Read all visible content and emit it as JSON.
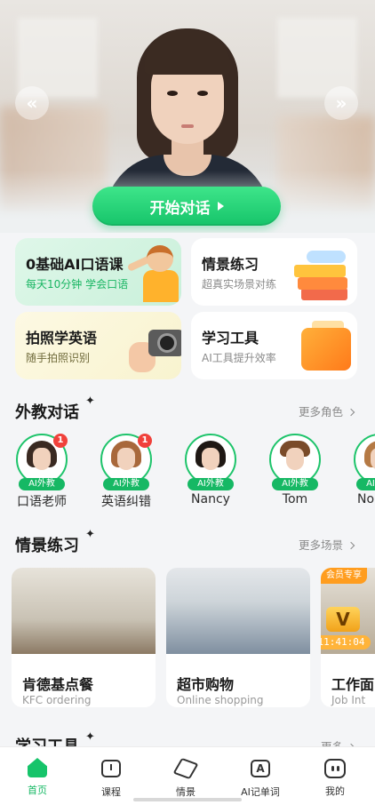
{
  "hero": {
    "start_button": "开始对话",
    "prev_icon": "double-chevron-left-icon",
    "next_icon": "double-chevron-right-icon"
  },
  "features": [
    {
      "title": "0基础AI口语课",
      "subtitle": "每天10分钟 学会口语"
    },
    {
      "title": "情景练习",
      "subtitle": "超真实场景对练"
    },
    {
      "title": "拍照学英语",
      "subtitle": "随手拍照识别"
    },
    {
      "title": "学习工具",
      "subtitle": "AI工具提升效率"
    }
  ],
  "tutors_section": {
    "title": "外教对话",
    "more": "更多角色",
    "tutors": [
      {
        "name": "口语老师",
        "badge": "AI外教",
        "unread": "1"
      },
      {
        "name": "英语纠错",
        "badge": "AI外教",
        "unread": "1"
      },
      {
        "name": "Nancy",
        "badge": "AI外教"
      },
      {
        "name": "Tom",
        "badge": "AI外教"
      },
      {
        "name": "No",
        "badge": "AI外教"
      }
    ]
  },
  "scenes_section": {
    "title": "情景练习",
    "more": "更多场景",
    "scenes": [
      {
        "title": "肯德基点餐",
        "subtitle": "KFC ordering"
      },
      {
        "title": "超市购物",
        "subtitle": "Online shopping"
      },
      {
        "title": "工作面",
        "subtitle": "Job Int",
        "tag": "会员专享",
        "timer": "11:41:04",
        "vip_mark": "V"
      }
    ]
  },
  "tools_section": {
    "title": "学习工具",
    "more": "更多"
  },
  "tabbar": {
    "tabs": [
      {
        "label": "首页",
        "icon": "home-icon",
        "active": true
      },
      {
        "label": "课程",
        "icon": "course-book-icon"
      },
      {
        "label": "情景",
        "icon": "cube-icon"
      },
      {
        "label": "AI记单词",
        "icon": "ai-words-icon"
      },
      {
        "label": "我的",
        "icon": "profile-face-icon"
      }
    ]
  },
  "colors": {
    "accent": "#16c46a",
    "badge_red": "#f0413b",
    "vip_orange": "#ff9d1f"
  }
}
